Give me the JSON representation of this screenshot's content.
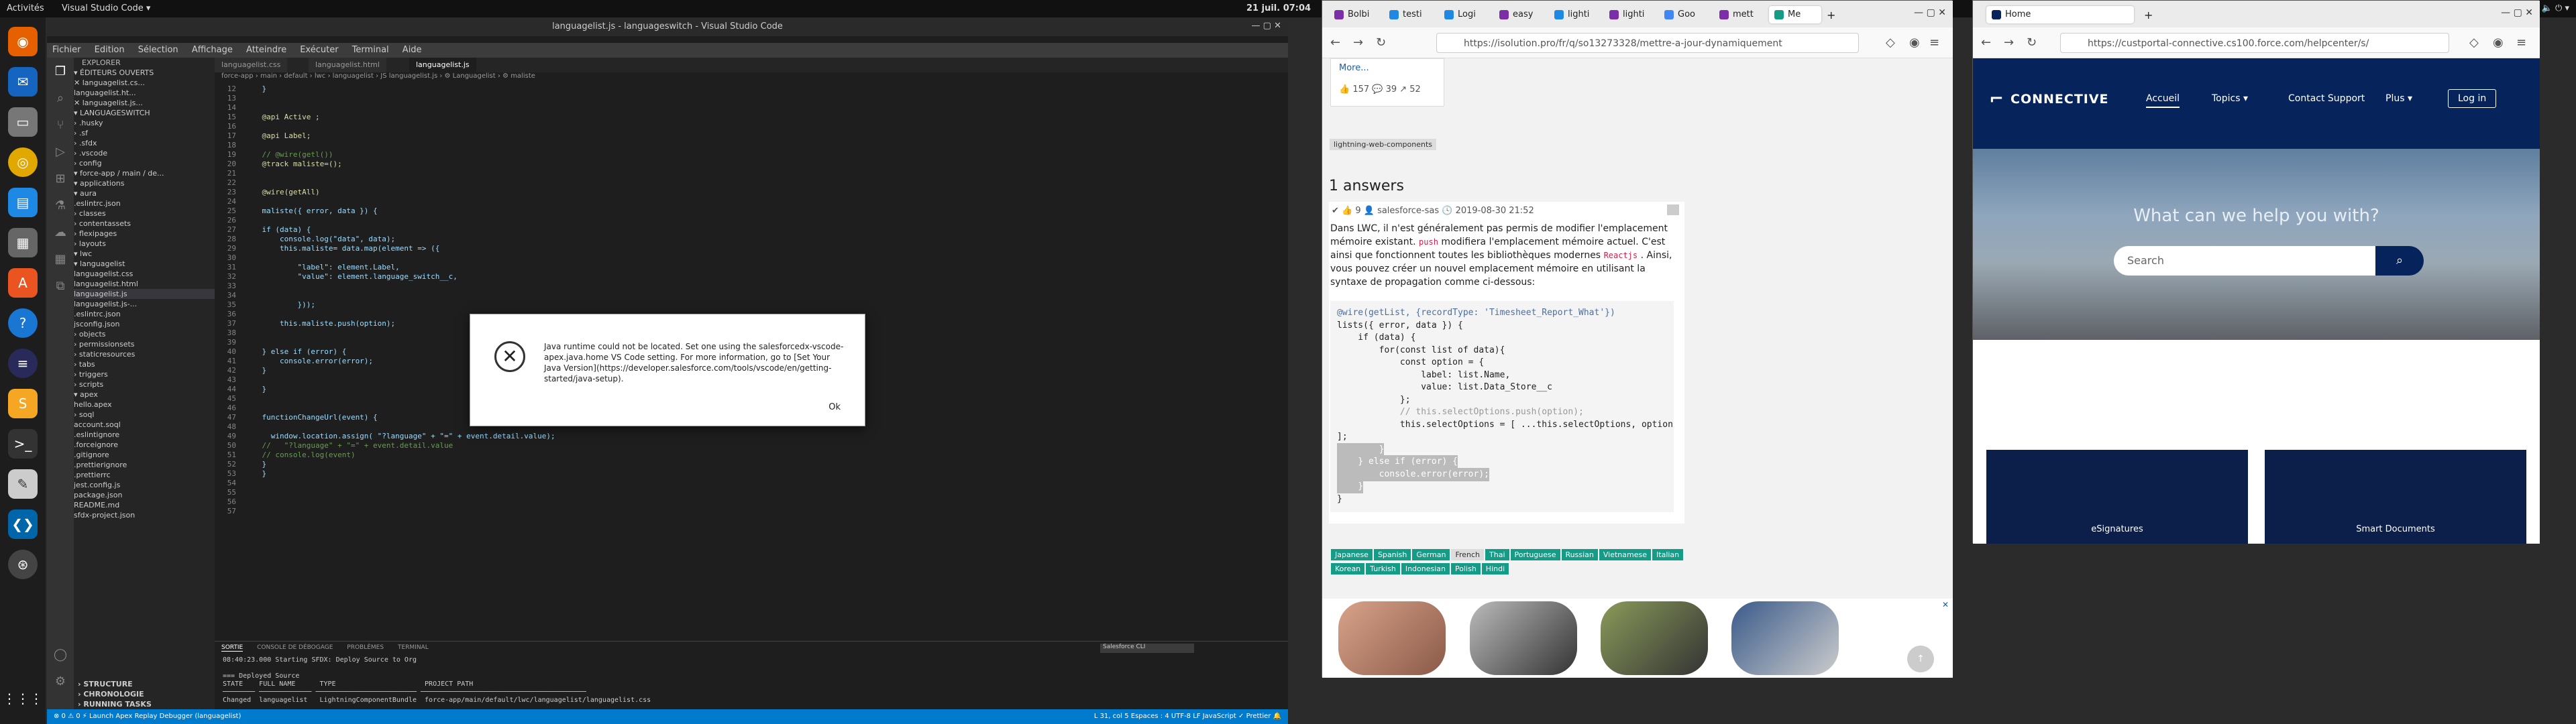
{
  "topbar": {
    "activities": "Activités",
    "app_name": "Visual Studio Code ▾",
    "clock": "21 juil. 07:04",
    "system": "⚙ 🔈 ⏻ ▾"
  },
  "vscode": {
    "title": "languagelist.js - languageswitch - Visual Studio Code",
    "menu": [
      "Fichier",
      "Edition",
      "Sélection",
      "Affichage",
      "Atteindre",
      "Exécuter",
      "Terminal",
      "Aide"
    ],
    "sidebar_title": "EXPLORER",
    "sidebar_rows": [
      "▾ ÉDITEURS OUVERTS",
      "   ✕ languagelist.cs...",
      "      languagelist.ht...",
      "   ✕ languagelist.js...",
      "▾ LANGUAGESWITCH",
      "  › .husky",
      "  › .sf",
      "  › .sfdx",
      "  › .vscode",
      "  › config",
      "  ▾ force-app / main / de...",
      "    ▾ applications",
      "    ▾ aura",
      "         .eslintrc.json",
      "    › classes",
      "    › contentassets",
      "    › flexipages",
      "    › layouts",
      "    ▾ lwc",
      "      ▾ languagelist",
      "         languagelist.css",
      "         languagelist.html",
      "         languagelist.js",
      "         languagelist.js-...",
      "         .eslintrc.json",
      "         jsconfig.json",
      "    › objects",
      "    › permissionsets",
      "    › staticresources",
      "    › tabs",
      "    › triggers",
      "  › scripts",
      "    ▾ apex",
      "         hello.apex",
      "    › soql",
      "         account.soql",
      "     .eslintignore",
      "     .forceignore",
      "     .gitignore",
      "     .prettierignore",
      "     .prettierrc",
      "     jest.config.js",
      "     package.json",
      "     README.md",
      "     sfdx-project.json"
    ],
    "sidebar_bottom": [
      "› STRUCTURE",
      "› CHRONOLOGIE",
      "› RUNNING TASKS"
    ],
    "tabs": [
      "languagelist.css",
      "languagelist.html",
      "languagelist.js"
    ],
    "breadcrumb": "force-app › main › default › lwc › languagelist › JS languagelist.js › ⚙ Languagelist › ⚙ maliste",
    "code_lines": [
      {
        "n": "12",
        "t": "    }"
      },
      {
        "n": "13",
        "t": ""
      },
      {
        "n": "14",
        "t": ""
      },
      {
        "n": "15",
        "t": "    @api Active ;"
      },
      {
        "n": "16",
        "t": ""
      },
      {
        "n": "17",
        "t": "    @api Label;"
      },
      {
        "n": "18",
        "t": ""
      },
      {
        "n": "19",
        "t": "    // @wire(getl())"
      },
      {
        "n": "20",
        "t": "    @track maliste=();"
      },
      {
        "n": "21",
        "t": ""
      },
      {
        "n": "22",
        "t": ""
      },
      {
        "n": "23",
        "t": "    @wire(getAll)"
      },
      {
        "n": "24",
        "t": ""
      },
      {
        "n": "25",
        "t": "    maliste({ error, data }) {"
      },
      {
        "n": "26",
        "t": ""
      },
      {
        "n": "27",
        "t": "    if (data) {"
      },
      {
        "n": "28",
        "t": "        console.log(\"data\", data);"
      },
      {
        "n": "29",
        "t": "        this.maliste= data.map(element => ({"
      },
      {
        "n": "30",
        "t": ""
      },
      {
        "n": "31",
        "t": "            \"label\": element.Label,"
      },
      {
        "n": "32",
        "t": "            \"value\": element.language_switch__c,"
      },
      {
        "n": "33",
        "t": ""
      },
      {
        "n": "34",
        "t": ""
      },
      {
        "n": "35",
        "t": "            }));"
      },
      {
        "n": "36",
        "t": ""
      },
      {
        "n": "37",
        "t": "        this.maliste.push(option);"
      },
      {
        "n": "38",
        "t": ""
      },
      {
        "n": "39",
        "t": ""
      },
      {
        "n": "40",
        "t": "    } else if (error) {"
      },
      {
        "n": "41",
        "t": "        console.error(error);"
      },
      {
        "n": "42",
        "t": "    }"
      },
      {
        "n": "43",
        "t": ""
      },
      {
        "n": "44",
        "t": "    }"
      },
      {
        "n": "45",
        "t": ""
      },
      {
        "n": "46",
        "t": ""
      },
      {
        "n": "47",
        "t": "    functionChangeUrl(event) {"
      },
      {
        "n": "48",
        "t": ""
      },
      {
        "n": "49",
        "t": "      window.location.assign( \"?language\" + \"=\" + event.detail.value);"
      },
      {
        "n": "50",
        "t": "    //   \"?language\" + \"=\" + event.detail.value"
      },
      {
        "n": "51",
        "t": "    // console.log(event)"
      },
      {
        "n": "52",
        "t": "    }"
      },
      {
        "n": "53",
        "t": "    }"
      },
      {
        "n": "54",
        "t": ""
      },
      {
        "n": "55",
        "t": ""
      },
      {
        "n": "56",
        "t": ""
      },
      {
        "n": "57",
        "t": ""
      }
    ],
    "panel_tabs": [
      "SORTIE",
      "CONSOLE DE DÉBOGAGE",
      "PROBLÈMES",
      "TERMINAL"
    ],
    "panel_select": "Salesforce CLI",
    "panel_lines": [
      "08:40:23.000 Starting SFDX: Deploy Source to Org",
      "",
      "=== Deployed Source",
      "STATE    FULL NAME      TYPE                      PROJECT PATH",
      "──────── ───────────── ───────────────────────── ─────────────────────────────────────────",
      "Changed  languagelist   LightningComponentBundle  force-app/main/default/lwc/languagelist/languagelist.css"
    ],
    "status_left": "⊗ 0 ⚠ 0   ⚡ Launch Apex Replay Debugger (languagelist)",
    "status_right": "L 31, col 5    Espaces : 4    UTF-8    LF    JavaScript    ✓ Prettier    🔔"
  },
  "dialog": {
    "message": "Java runtime could not be located. Set one using the salesforcedx-vscode-apex.java.home VS Code setting. For more information, go to [Set Your Java Version](https://developer.salesforce.com/tools/vscode/en/getting-started/java-setup).",
    "ok": "Ok"
  },
  "firefox1": {
    "tabs": [
      "Bolbi",
      "testi",
      "Logi",
      "easy",
      "lighti",
      "lighti",
      "Goo",
      "mett",
      "Me",
      "Mettre à jour..."
    ],
    "url": "https://isolution.pro/fr/q/so13273328/mettre-a-jour-dynamiquement",
    "more_link": "More...",
    "stats": "👍 157  💬 39  ↗ 52",
    "tag_lwc": "lightning-web-components",
    "answers_heading": "1 answers",
    "answer_meta": "✔ 👍 9 👤 salesforce-sas 🕓 2019-08-30 21:52",
    "answer_text_1": "Dans LWC, il n'est généralement pas permis de modifier l'emplacement mémoire existant.",
    "answer_push": "push",
    "answer_text_2": "modifiera l'emplacement mémoire actuel. C'est ainsi que fonctionnent toutes les bibliothèques modernes",
    "answer_reactjs": "Reactjs",
    "answer_text_3": ". Ainsi, vous pouvez créer un nouvel emplacement mémoire en utilisant la syntaxe de propagation comme ci-dessous:",
    "code": [
      "@wire(getList, {recordType: 'Timesheet_Report_What'})",
      "lists({ error, data }) {",
      "    if (data) {",
      "        for(const list of data){",
      "            const option = {",
      "                label: list.Name,",
      "                value: list.Data_Store__c",
      "            };",
      "            // this.selectOptions.push(option);",
      "            this.selectOptions = [ ...this.selectOptions, option",
      "];",
      "        }",
      "    } else if (error) {",
      "        console.error(error);",
      "    }",
      "}"
    ],
    "languages": [
      "Japanese",
      "Spanish",
      "German",
      "French",
      "Thai",
      "Portuguese",
      "Russian",
      "Vietnamese",
      "Italian",
      "Korean",
      "Turkish",
      "Indonesian",
      "Polish",
      "Hindi"
    ],
    "selected_language": "French"
  },
  "firefox2": {
    "tab": "Home",
    "url": "https://custportal-connective.cs100.force.com/helpcenter/s/",
    "logo": "CONNECTIVE",
    "nav": [
      "Accueil",
      "Topics ▾",
      "Contact Support",
      "Plus ▾"
    ],
    "login": "Log in",
    "hero_title": "What can we help you with?",
    "search_placeholder": "Search",
    "tiles": [
      "eSignatures",
      "Smart Documents"
    ]
  }
}
